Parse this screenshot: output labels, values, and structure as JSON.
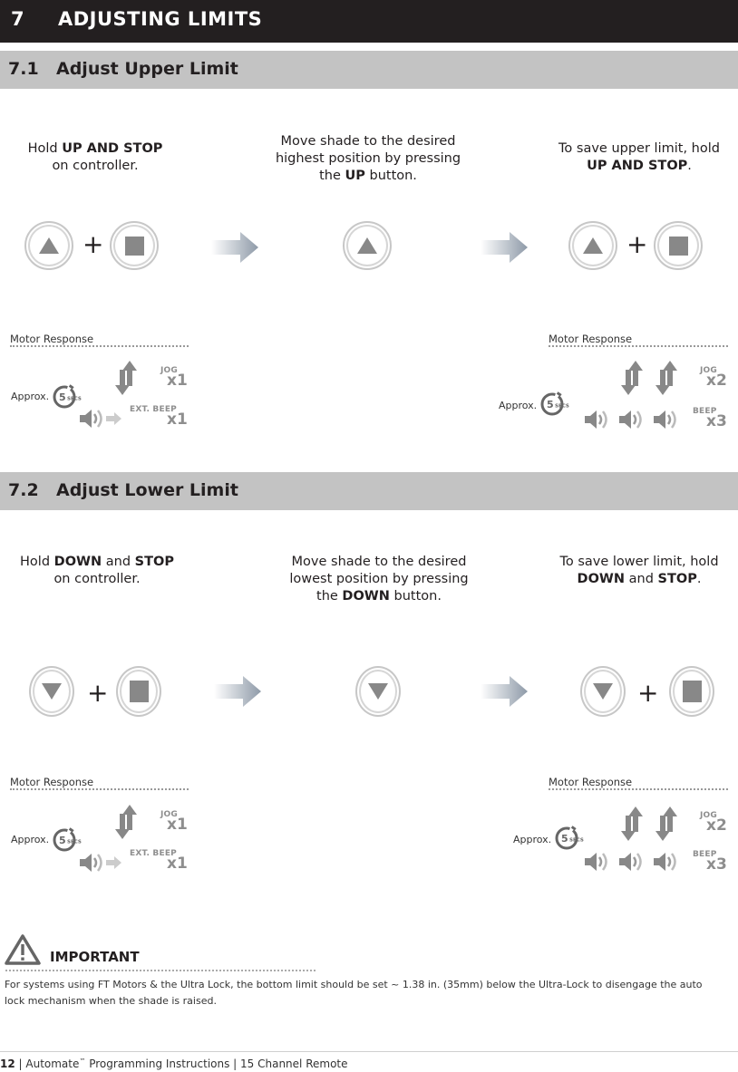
{
  "header": {
    "number": "7",
    "title": "ADJUSTING LIMITS"
  },
  "sections": [
    {
      "number": "7.1",
      "title": "Adjust Upper Limit",
      "steps": [
        {
          "pre": "Hold ",
          "bold1": "UP AND STOP",
          "mid": "",
          "bold2": "",
          "line2": "on controller.",
          "buttons": [
            "up",
            "stop"
          ]
        },
        {
          "line1": "Move shade to the desired",
          "line2": "highest position by pressing",
          "pre3": "the ",
          "bold3": "UP",
          "post3": " button.",
          "buttons": [
            "up"
          ]
        },
        {
          "line1": "To save upper limit, hold",
          "bold2a": "UP AND STOP",
          "mid2": "",
          "bold2b": "",
          "post2": ".",
          "buttons": [
            "up",
            "stop"
          ]
        }
      ],
      "responses": [
        {
          "label": "Motor Response",
          "approx": "Approx.",
          "timer": "5",
          "timer_unit": "SECS",
          "jog_label": "JOG",
          "jog_count": "x1",
          "beep_label": "EXT. BEEP",
          "beep_count": "x1"
        },
        {
          "label": "Motor Response",
          "approx": "Approx.",
          "timer": "5",
          "timer_unit": "SECS",
          "jog_label": "JOG",
          "jog_count": "x2",
          "beep_label": "BEEP",
          "beep_count": "x3"
        }
      ]
    },
    {
      "number": "7.2",
      "title": "Adjust Lower Limit",
      "steps": [
        {
          "pre": "Hold ",
          "bold1": "DOWN",
          "mid": " and ",
          "bold2": "STOP",
          "line2": "on controller.",
          "buttons": [
            "down",
            "stop"
          ]
        },
        {
          "line1": "Move shade to the desired",
          "line2": "lowest position by pressing",
          "pre3": "the ",
          "bold3": "DOWN",
          "post3": " button.",
          "buttons": [
            "down"
          ]
        },
        {
          "line1": "To save lower limit, hold",
          "bold2a": "DOWN",
          "mid2": " and ",
          "bold2b": "STOP",
          "post2": ".",
          "buttons": [
            "down",
            "stop"
          ]
        }
      ],
      "responses": [
        {
          "label": "Motor Response",
          "approx": "Approx.",
          "timer": "5",
          "timer_unit": "SECS",
          "jog_label": "JOG",
          "jog_count": "x1",
          "beep_label": "EXT. BEEP",
          "beep_count": "x1"
        },
        {
          "label": "Motor Response",
          "approx": "Approx.",
          "timer": "5",
          "timer_unit": "SECS",
          "jog_label": "JOG",
          "jog_count": "x2",
          "beep_label": "BEEP",
          "beep_count": "x3"
        }
      ]
    }
  ],
  "important": {
    "title": "IMPORTANT",
    "text_line1": "For systems using FT Motors & the Ultra Lock, the bottom limit should be set ~ 1.38 in. (35mm) below the Ultra-Lock to disengage the auto",
    "text_line2": "lock mechanism when the shade is raised."
  },
  "footer": {
    "page": "12",
    "sep1": " | ",
    "brand": "Automate",
    "tm": "™",
    "doc": " Programming Instructions | 15 Channel Remote"
  },
  "plus_sign": "+"
}
